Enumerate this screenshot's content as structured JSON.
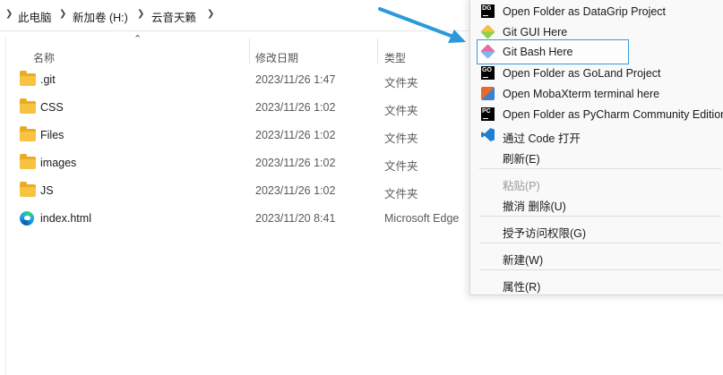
{
  "breadcrumb": {
    "items": [
      "此电脑",
      "新加卷 (H:)",
      "云音天籁"
    ]
  },
  "columns": {
    "name": "名称",
    "modified": "修改日期",
    "type": "类型"
  },
  "files": [
    {
      "name": ".git",
      "modified": "2023/11/26 1:47",
      "type": "文件夹",
      "icon": "folder-icon"
    },
    {
      "name": "CSS",
      "modified": "2023/11/26 1:02",
      "type": "文件夹",
      "icon": "folder-icon"
    },
    {
      "name": "Files",
      "modified": "2023/11/26 1:02",
      "type": "文件夹",
      "icon": "folder-icon"
    },
    {
      "name": "images",
      "modified": "2023/11/26 1:02",
      "type": "文件夹",
      "icon": "folder-icon"
    },
    {
      "name": "JS",
      "modified": "2023/11/26 1:02",
      "type": "文件夹",
      "icon": "folder-icon"
    },
    {
      "name": "index.html",
      "modified": "2023/11/20 8:41",
      "type": "Microsoft Edge",
      "icon": "edge-icon"
    }
  ],
  "context_menu": {
    "items": [
      {
        "label": "Open Folder as DataGrip Project",
        "icon": "datagrip-icon",
        "badge": "DG"
      },
      {
        "label": "Git GUI Here",
        "icon": "git-gui-icon"
      },
      {
        "label": "Git Bash Here",
        "icon": "git-bash-icon",
        "highlighted": true
      },
      {
        "label": "Open Folder as GoLand Project",
        "icon": "goland-icon",
        "badge": "GO"
      },
      {
        "label": "Open MobaXterm terminal here",
        "icon": "mobaxterm-icon"
      },
      {
        "label": "Open Folder as PyCharm Community Edition",
        "icon": "pycharm-icon",
        "badge": "PC"
      },
      {
        "label": "通过 Code 打开",
        "icon": "vscode-icon"
      },
      {
        "label": "刷新(E)"
      },
      {
        "label": "粘贴(P)",
        "disabled": true
      },
      {
        "label": "撤消 删除(U)"
      },
      {
        "label": "授予访问权限(G)"
      },
      {
        "label": "新建(W)"
      },
      {
        "label": "属性(R)"
      }
    ]
  },
  "colors": {
    "highlight_border": "#3b9ad6",
    "arrow": "#2b9ad8",
    "folder": "#f6c343"
  }
}
